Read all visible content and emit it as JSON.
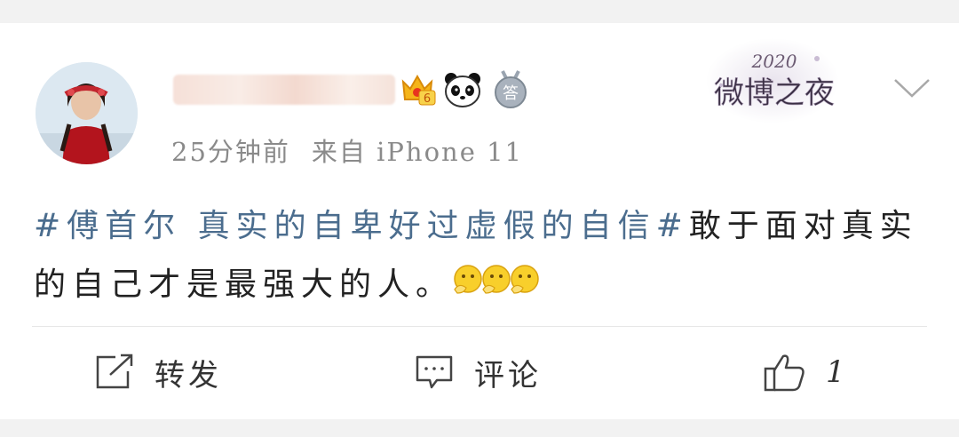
{
  "post": {
    "time": "25分钟前",
    "source": "来自 iPhone 11",
    "topic": "#傅首尔 真实的自卑好过虚假的自信#",
    "body": "敢于面对真实的自己才是最强大的人。",
    "emoji_count": 3,
    "emoji_name": "face-thinking-emoji"
  },
  "badges": {
    "member_level": "6",
    "answer_badge": "答"
  },
  "event_logo": {
    "year": "2020",
    "title": "微博之夜"
  },
  "actions": {
    "repost_label": "转发",
    "comment_label": "评论",
    "like_count": "1"
  },
  "colors": {
    "topic_link": "#4b6d8e",
    "text": "#222222",
    "meta": "#8a8a8a",
    "background": "#f2f2f2"
  }
}
